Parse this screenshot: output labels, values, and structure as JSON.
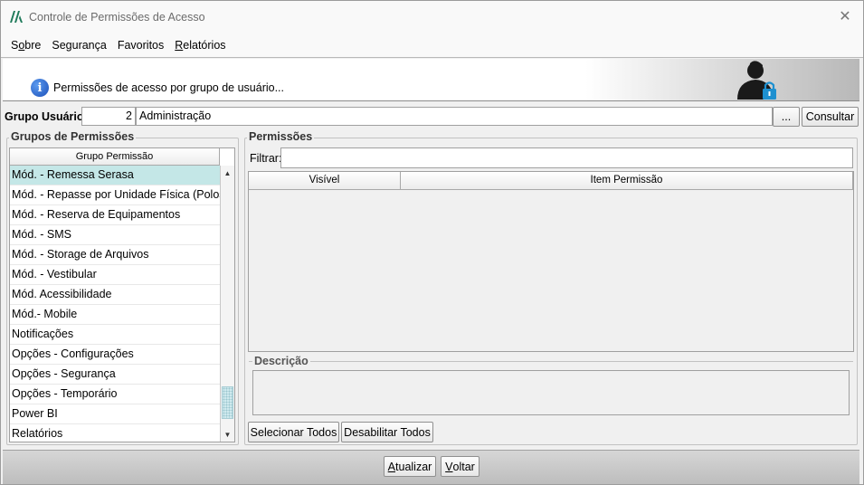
{
  "window": {
    "title": "Controle de Permissões de Acesso",
    "close_glyph": "✕"
  },
  "menu": {
    "items": [
      {
        "first": "S",
        "underline": "o",
        "rest": "bre"
      },
      {
        "first": "Segurança",
        "underline": "",
        "rest": ""
      },
      {
        "first": "Favoritos",
        "underline": "",
        "rest": ""
      },
      {
        "first": "",
        "underline": "R",
        "rest": "elatórios"
      }
    ]
  },
  "banner": {
    "text": "Permissões de acesso por grupo de usuário...",
    "info_glyph": "i"
  },
  "grupo_usuario": {
    "label": "Grupo Usuário:",
    "id": "2",
    "name": "Administração",
    "ellipsis_label": "...",
    "consultar_label": "Consultar"
  },
  "grupos_permissoes": {
    "title": "Grupos de Permissões",
    "column_header": "Grupo Permissão",
    "rows": [
      "Mód. - Remessa Serasa",
      "Mód. - Repasse por Unidade Física (Polos)",
      "Mód. - Reserva de Equipamentos",
      "Mód. - SMS",
      "Mód. - Storage de Arquivos",
      "Mód. - Vestibular",
      "Mód. Acessibilidade",
      "Mód.- Mobile",
      "Notificações",
      "Opções - Configurações",
      "Opções - Segurança",
      "Opções - Temporário",
      "Power BI",
      "Relatórios"
    ],
    "selected_index": 0,
    "scroll_up_glyph": "▲",
    "scroll_down_glyph": "▼"
  },
  "permissoes": {
    "title": "Permissões",
    "filter_label": "Filtrar:",
    "filter_value": "",
    "columns": [
      "Visível",
      "Item Permissão"
    ],
    "descricao_label": "Descrição",
    "select_all_label": "Selecionar Todos",
    "disable_all_label": "Desabilitar Todos"
  },
  "footer": {
    "atualizar": {
      "underline": "A",
      "rest": "tualizar"
    },
    "voltar": {
      "underline": "V",
      "rest": "oltar"
    }
  },
  "colors": {
    "selected_row": "#c4e7e7",
    "window_bg": "#f0f0f0",
    "info_icon": "#1c4fb8",
    "lock_icon": "#1e90d0"
  }
}
